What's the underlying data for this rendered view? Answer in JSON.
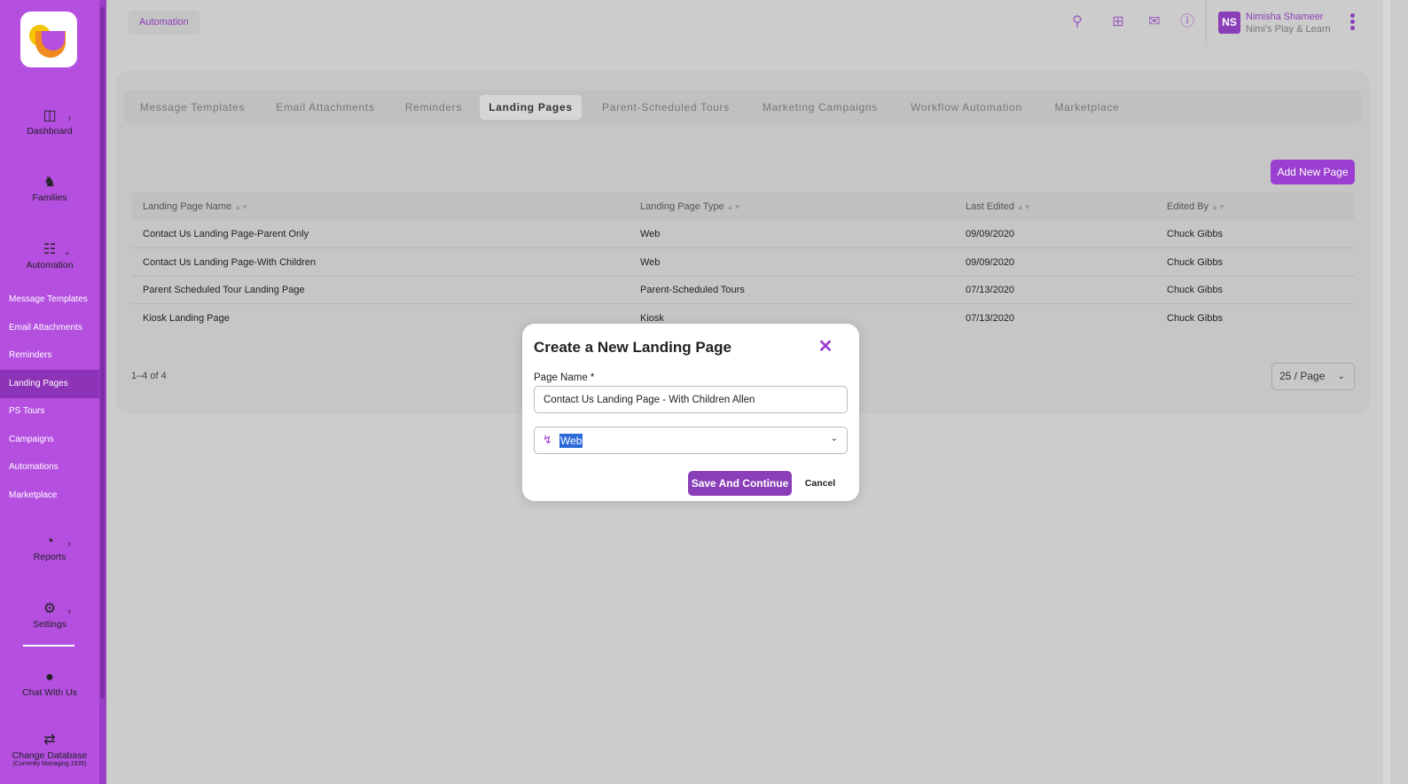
{
  "sidebar": {
    "items": [
      {
        "label": "Dashboard",
        "icon": "layout-icon"
      },
      {
        "label": "Families",
        "icon": "people-icon"
      },
      {
        "label": "Automation",
        "icon": "automation-icon"
      },
      {
        "label": "Reports",
        "icon": "pie-chart-icon"
      },
      {
        "label": "Settings",
        "icon": "gear-icon"
      },
      {
        "label": "Chat With Us",
        "icon": "chat-icon"
      },
      {
        "label": "Change Database",
        "sublabel": "(Currently Managing 1935)",
        "icon": "swap-icon"
      }
    ],
    "submenu": [
      "Message Templates",
      "Email Attachments",
      "Reminders",
      "Landing Pages",
      "PS Tours",
      "Campaigns",
      "Automations",
      "Marketplace"
    ],
    "active_sub": "Landing Pages"
  },
  "header": {
    "breadcrumb": "Automation",
    "user": {
      "initials": "NS",
      "name": "Nimisha Shameer",
      "org": "Nimi's Play & Learn"
    }
  },
  "tabs": [
    "Message Templates",
    "Email Attachments",
    "Reminders",
    "Landing Pages",
    "Parent-Scheduled Tours",
    "Marketing Campaigns",
    "Workflow Automation",
    "Marketplace"
  ],
  "active_tab": "Landing Pages",
  "add_button": "Add New Page",
  "table": {
    "columns": [
      "Landing Page Name",
      "Landing Page Type",
      "Last Edited",
      "Edited By"
    ],
    "rows": [
      [
        "Contact Us Landing Page-Parent Only",
        "Web",
        "09/09/2020",
        "Chuck Gibbs"
      ],
      [
        "Contact Us Landing Page-With Children",
        "Web",
        "09/09/2020",
        "Chuck Gibbs"
      ],
      [
        "Parent Scheduled Tour Landing Page",
        "Parent-Scheduled Tours",
        "07/13/2020",
        "Chuck Gibbs"
      ],
      [
        "Kiosk Landing Page",
        "Kiosk",
        "07/13/2020",
        "Chuck Gibbs"
      ]
    ]
  },
  "pagination": {
    "range": "1–4 of 4",
    "per_page": "25 / Page"
  },
  "modal": {
    "title": "Create a New Landing Page",
    "page_name_label": "Page Name *",
    "page_name_value": "Contact Us Landing Page - With Children Allen",
    "type_value": "Web",
    "save_label": "Save And Continue",
    "cancel_label": "Cancel"
  }
}
